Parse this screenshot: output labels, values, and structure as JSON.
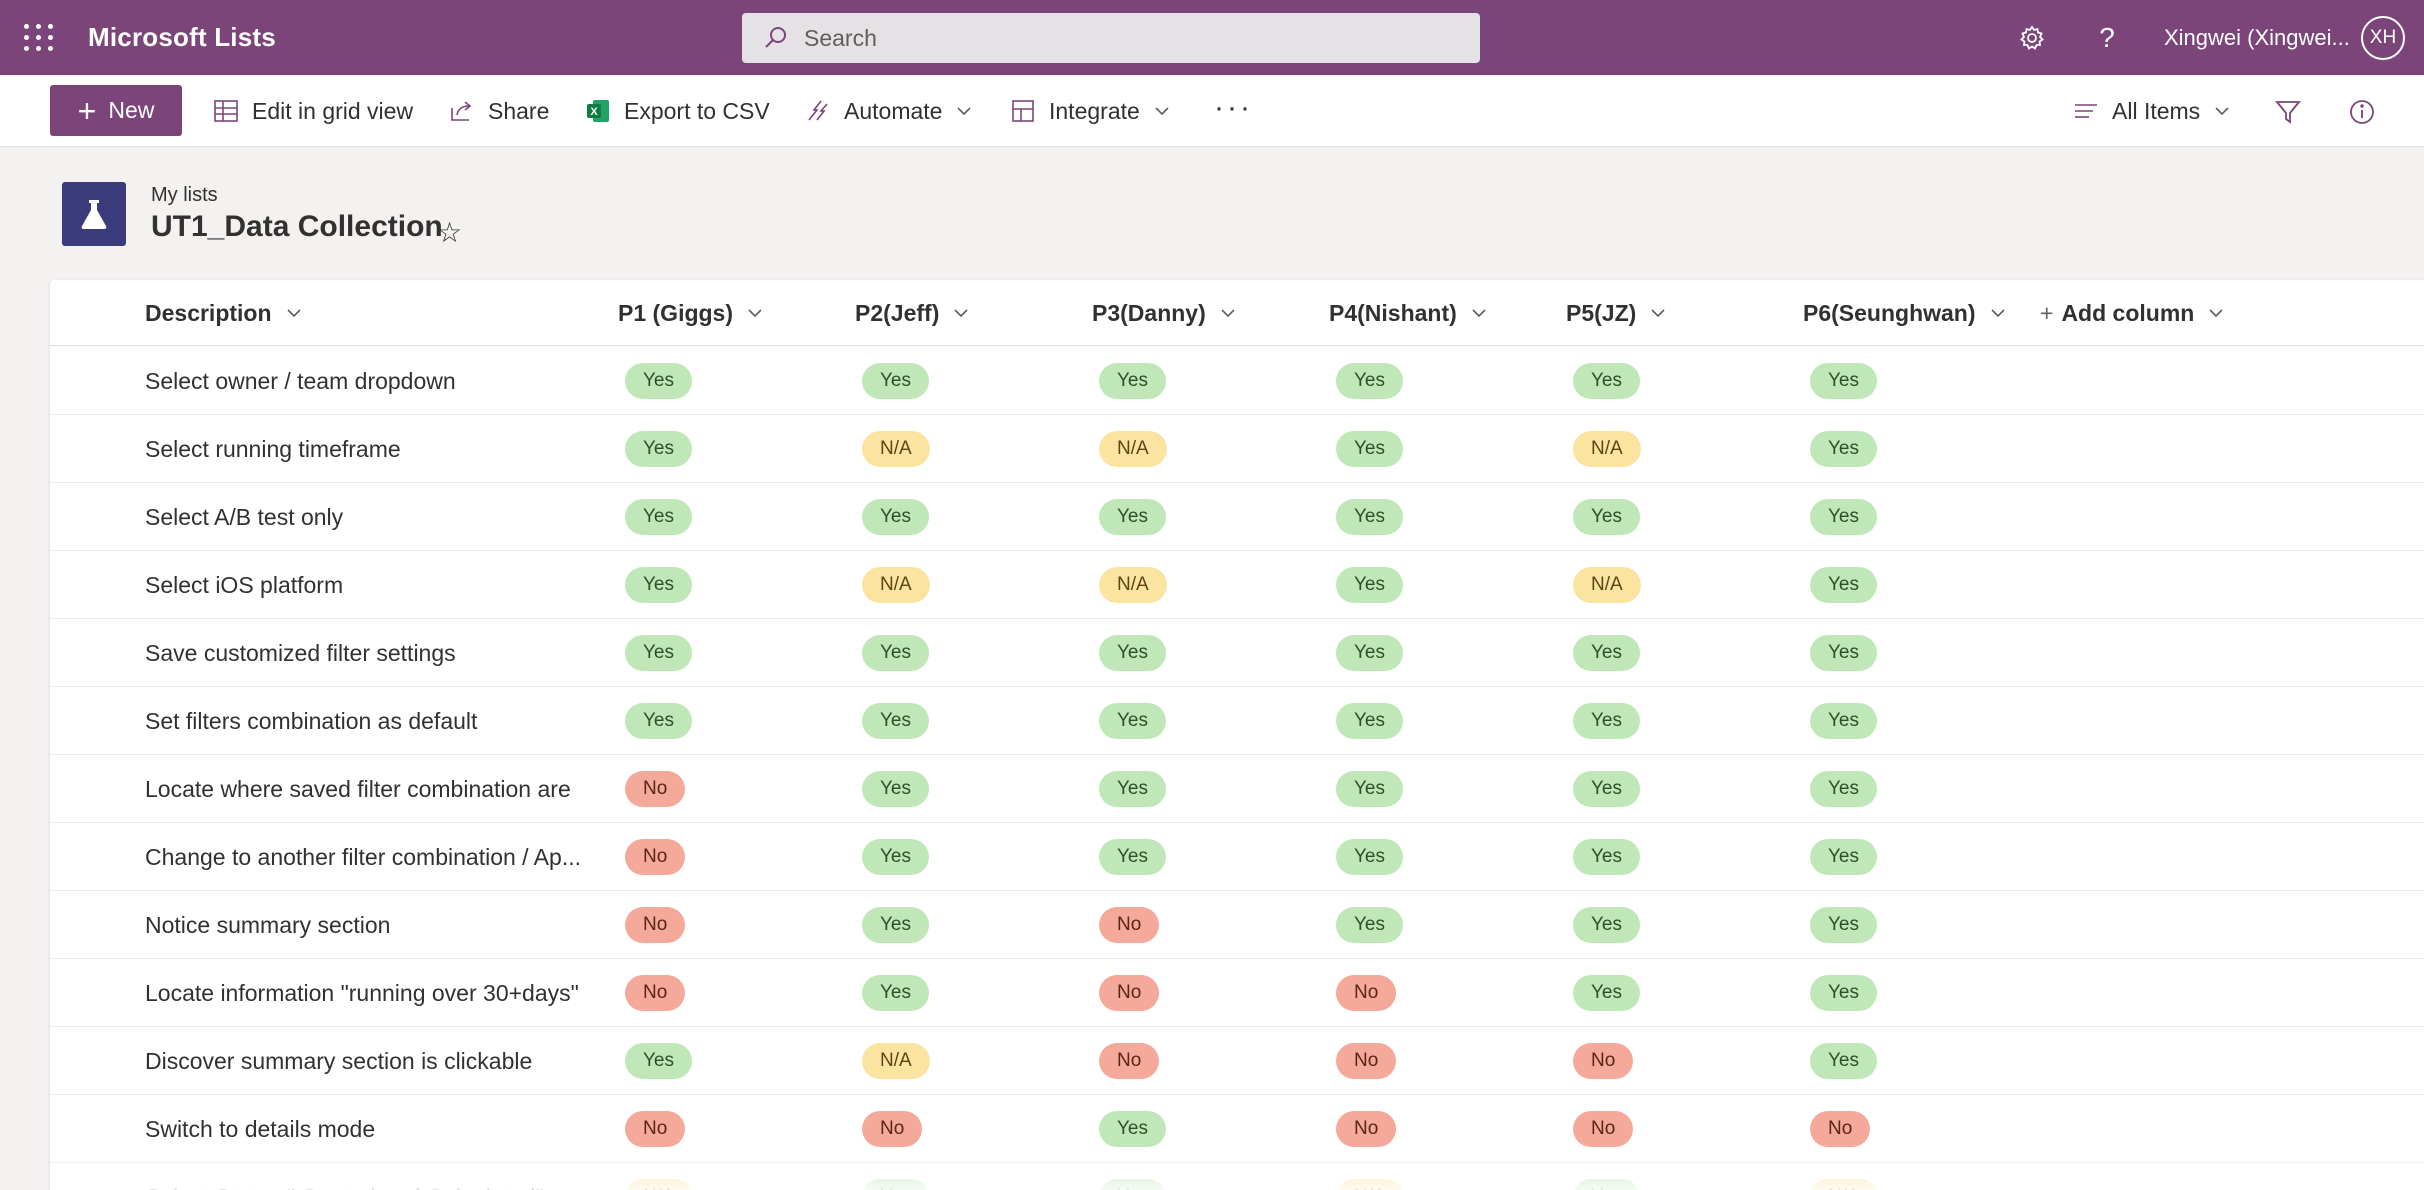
{
  "suite": {
    "app_title": "Microsoft Lists",
    "search_placeholder": "Search",
    "user_name": "Xingwei (Xingwei...",
    "avatar_initials": "XH",
    "brand_color": "#7b4579"
  },
  "commands": {
    "new": "New",
    "edit_grid": "Edit in grid view",
    "share": "Share",
    "export": "Export to CSV",
    "automate": "Automate",
    "integrate": "Integrate",
    "view": "All Items"
  },
  "list": {
    "breadcrumb": "My lists",
    "title": "UT1_Data Collection"
  },
  "columns": [
    "Description",
    "P1 (Giggs)",
    "P2(Jeff)",
    "P3(Danny)",
    "P4(Nishant)",
    "P5(JZ)",
    "P6(Seunghwan)"
  ],
  "add_column": "Add column",
  "rows": [
    {
      "desc": "Select owner / team dropdown",
      "vals": [
        "Yes",
        "Yes",
        "Yes",
        "Yes",
        "Yes",
        "Yes"
      ]
    },
    {
      "desc": "Select running timeframe",
      "vals": [
        "Yes",
        "N/A",
        "N/A",
        "Yes",
        "N/A",
        "Yes"
      ]
    },
    {
      "desc": "Select A/B test only",
      "vals": [
        "Yes",
        "Yes",
        "Yes",
        "Yes",
        "Yes",
        "Yes"
      ]
    },
    {
      "desc": "Select iOS platform",
      "vals": [
        "Yes",
        "N/A",
        "N/A",
        "Yes",
        "N/A",
        "Yes"
      ]
    },
    {
      "desc": "Save customized filter settings",
      "vals": [
        "Yes",
        "Yes",
        "Yes",
        "Yes",
        "Yes",
        "Yes"
      ]
    },
    {
      "desc": "Set filters combination as default",
      "vals": [
        "Yes",
        "Yes",
        "Yes",
        "Yes",
        "Yes",
        "Yes"
      ]
    },
    {
      "desc": "Locate where saved filter combination are",
      "vals": [
        "No",
        "Yes",
        "Yes",
        "Yes",
        "Yes",
        "Yes"
      ]
    },
    {
      "desc": "Change to another filter combination / Ap...",
      "vals": [
        "No",
        "Yes",
        "Yes",
        "Yes",
        "Yes",
        "Yes"
      ]
    },
    {
      "desc": "Notice summary section",
      "vals": [
        "No",
        "Yes",
        "No",
        "Yes",
        "Yes",
        "Yes"
      ]
    },
    {
      "desc": "Locate information \"running over 30+days\"",
      "vals": [
        "No",
        "Yes",
        "No",
        "No",
        "Yes",
        "Yes"
      ]
    },
    {
      "desc": "Discover summary section is clickable",
      "vals": [
        "Yes",
        "N/A",
        "No",
        "No",
        "No",
        "Yes"
      ]
    },
    {
      "desc": "Switch to details mode",
      "vals": [
        "No",
        "No",
        "Yes",
        "No",
        "No",
        "No"
      ]
    },
    {
      "desc": "Select Status \" Started and Calculated\"",
      "vals": [
        "N/A",
        "Yes",
        "Yes",
        "N/A",
        "Yes",
        "N/A"
      ]
    }
  ],
  "status_colors": {
    "Yes": "#bfe7b7",
    "N/A": "#fbe3a0",
    "No": "#f4a99a"
  }
}
